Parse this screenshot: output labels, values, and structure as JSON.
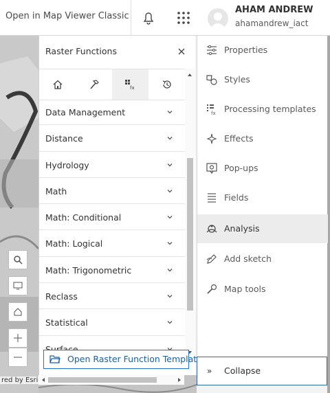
{
  "header": {
    "open_classic": "Open in Map Viewer Classic",
    "user_name": "AHAM ANDREW",
    "user_handle": "ahamandrew_iact"
  },
  "map": {
    "attribution": "red by Esri"
  },
  "raster_panel": {
    "title": "Raster Functions",
    "tabs": [
      {
        "icon": "home-icon"
      },
      {
        "icon": "hammer-icon"
      },
      {
        "icon": "raster-function-icon",
        "active": true
      },
      {
        "icon": "history-icon"
      }
    ],
    "categories": [
      "Data Management",
      "Distance",
      "Hydrology",
      "Math",
      "Math: Conditional",
      "Math: Logical",
      "Math: Trigonometric",
      "Reclass",
      "Statistical",
      "Surface"
    ],
    "open_template": "Open Raster Function Template"
  },
  "sidebar": {
    "items": [
      {
        "label": "Properties",
        "icon": "properties-icon"
      },
      {
        "label": "Styles",
        "icon": "styles-icon"
      },
      {
        "label": "Processing templates",
        "icon": "processing-templates-icon"
      },
      {
        "label": "Effects",
        "icon": "effects-icon"
      },
      {
        "label": "Pop-ups",
        "icon": "popups-icon"
      },
      {
        "label": "Fields",
        "icon": "fields-icon"
      },
      {
        "label": "Analysis",
        "icon": "analysis-icon",
        "active": true
      },
      {
        "label": "Add sketch",
        "icon": "sketch-icon"
      },
      {
        "label": "Map tools",
        "icon": "map-tools-icon"
      }
    ],
    "collapse": "Collapse"
  },
  "colors": {
    "accent": "#1b74c9",
    "panel_bg": "#ffffff",
    "active_bg": "#ececec"
  }
}
